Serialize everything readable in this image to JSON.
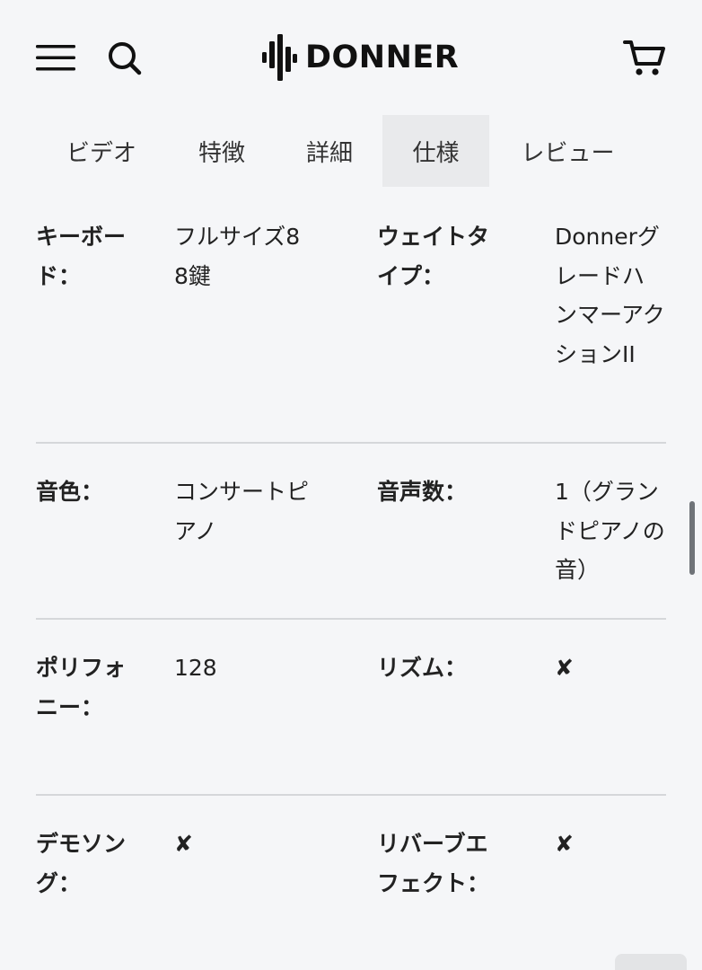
{
  "header": {
    "brand": "DONNER",
    "icons": {
      "menu": "hamburger-menu-icon",
      "search": "search-icon",
      "cart": "cart-icon"
    }
  },
  "tabs": [
    {
      "label": "ビデオ",
      "active": false
    },
    {
      "label": "特徴",
      "active": false
    },
    {
      "label": "詳細",
      "active": false
    },
    {
      "label": "仕様",
      "active": true
    },
    {
      "label": "レビュー",
      "active": false
    }
  ],
  "specs": [
    {
      "label1": "キーボード：",
      "value1": "フルサイズ88鍵",
      "label2": "ウェイトタイプ：",
      "value2": "DonnerグレードハンマーアクションII"
    },
    {
      "label1": "音色：",
      "value1": "コンサートピアノ",
      "label2": "音声数：",
      "value2": "1（グランドピアノの音）"
    },
    {
      "label1": "ポリフォニー：",
      "value1": "128",
      "label2": "リズム：",
      "value2": "✘"
    },
    {
      "label1": "デモソング：",
      "value1": "✘",
      "label2": "リバーブエフェクト：",
      "value2": "✘"
    }
  ],
  "colors": {
    "background": "#f5f6f8",
    "active_tab": "#e9eaec",
    "divider": "#d5d7da",
    "text": "#222222"
  }
}
